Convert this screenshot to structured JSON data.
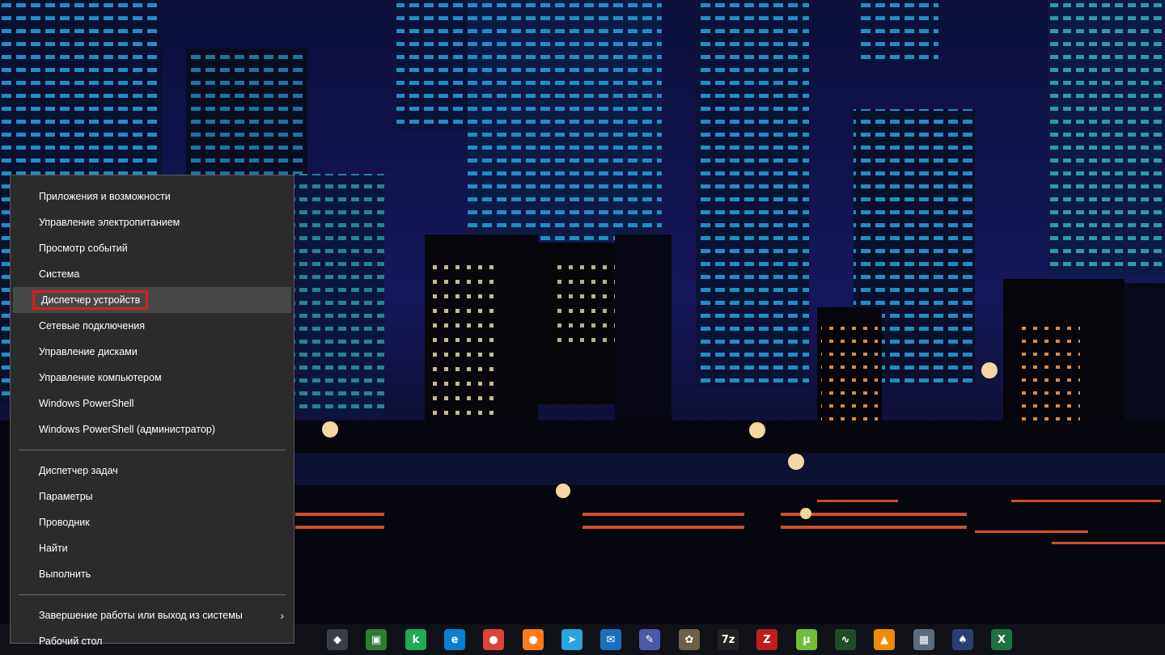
{
  "menu": {
    "items": [
      {
        "label": "Приложения и возможности"
      },
      {
        "label": "Управление электропитанием"
      },
      {
        "label": "Просмотр событий"
      },
      {
        "label": "Система"
      },
      {
        "label": "Диспетчер устройств"
      },
      {
        "label": "Сетевые подключения"
      },
      {
        "label": "Управление дисками"
      },
      {
        "label": "Управление компьютером"
      },
      {
        "label": "Windows PowerShell"
      },
      {
        "label": "Windows PowerShell (администратор)"
      },
      {
        "label": "Диспетчер задач"
      },
      {
        "label": "Параметры"
      },
      {
        "label": "Проводник"
      },
      {
        "label": "Найти"
      },
      {
        "label": "Выполнить"
      },
      {
        "label": "Завершение работы или выход из системы"
      },
      {
        "label": "Рабочий стол"
      }
    ],
    "highlight_color": "#d81e1e",
    "submenu_arrow": "›"
  },
  "taskbar": {
    "icons": [
      {
        "name": "inkscape-icon",
        "glyph": "◆",
        "color": "#3a3d46"
      },
      {
        "name": "chat-app-icon",
        "glyph": "▣",
        "color": "#2e7d32"
      },
      {
        "name": "kaspersky-icon",
        "glyph": "k",
        "color": "#1faa59"
      },
      {
        "name": "edge-browser-icon",
        "glyph": "e",
        "color": "#0a7fd1"
      },
      {
        "name": "chrome-browser-icon",
        "glyph": "●",
        "color": "#db4437"
      },
      {
        "name": "firefox-browser-icon",
        "glyph": "●",
        "color": "#ff7a18"
      },
      {
        "name": "telegram-icon",
        "glyph": "➤",
        "color": "#2aa3df"
      },
      {
        "name": "thunderbird-icon",
        "glyph": "✉",
        "color": "#1c6fc0"
      },
      {
        "name": "paint-icon",
        "glyph": "✎",
        "color": "#4a5aa8"
      },
      {
        "name": "gimp-icon",
        "glyph": "✿",
        "color": "#6d5f4b"
      },
      {
        "name": "sevenzip-icon",
        "glyph": "7z",
        "color": "#222222"
      },
      {
        "name": "filezilla-icon",
        "glyph": "Z",
        "color": "#bf1e1e"
      },
      {
        "name": "utorrent-icon",
        "glyph": "µ",
        "color": "#6fbf3a"
      },
      {
        "name": "monitor-app-icon",
        "glyph": "∿",
        "color": "#1f4d2a"
      },
      {
        "name": "vlc-icon",
        "glyph": "▲",
        "color": "#f08a00"
      },
      {
        "name": "calculator-icon",
        "glyph": "▦",
        "color": "#5b6b7b"
      },
      {
        "name": "solitaire-icon",
        "glyph": "♠",
        "color": "#2c3e70"
      },
      {
        "name": "excel-icon",
        "glyph": "X",
        "color": "#1d7044"
      }
    ]
  }
}
